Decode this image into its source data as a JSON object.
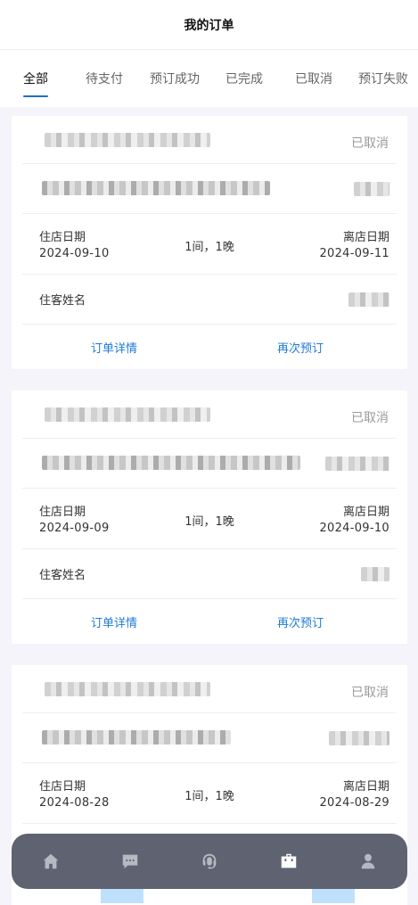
{
  "header": {
    "title": "我的订单"
  },
  "tabs": [
    {
      "label": "全部",
      "active": true
    },
    {
      "label": "待支付",
      "active": false
    },
    {
      "label": "预订成功",
      "active": false
    },
    {
      "label": "已完成",
      "active": false
    },
    {
      "label": "已取消",
      "active": false
    },
    {
      "label": "预订失败",
      "active": false
    }
  ],
  "orders": [
    {
      "status": "已取消",
      "checkin_label": "住店日期",
      "checkin_date": "2024-09-10",
      "duration": "1间，1晚",
      "checkout_label": "离店日期",
      "checkout_date": "2024-09-11",
      "guest_label": "住客姓名",
      "detail_label": "订单详情",
      "rebook_label": "再次预订"
    },
    {
      "status": "已取消",
      "checkin_label": "住店日期",
      "checkin_date": "2024-09-09",
      "duration": "1间，1晚",
      "checkout_label": "离店日期",
      "checkout_date": "2024-09-10",
      "guest_label": "住客姓名",
      "detail_label": "订单详情",
      "rebook_label": "再次预订"
    },
    {
      "status": "已取消",
      "checkin_label": "住店日期",
      "checkin_date": "2024-08-28",
      "duration": "1间，1晚",
      "checkout_label": "离店日期",
      "checkout_date": "2024-08-29"
    }
  ],
  "bottom_nav": [
    {
      "icon": "home-icon",
      "active": false
    },
    {
      "icon": "message-icon",
      "active": false
    },
    {
      "icon": "customer-service-icon",
      "active": false
    },
    {
      "icon": "orders-icon",
      "active": true
    },
    {
      "icon": "profile-icon",
      "active": false
    }
  ]
}
